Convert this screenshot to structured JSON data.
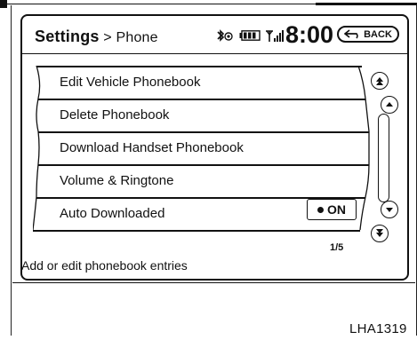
{
  "header": {
    "breadcrumb_settings": "Settings",
    "breadcrumb_separator": ">",
    "breadcrumb_current": "Phone",
    "time": "8:00",
    "back_label": "BACK",
    "status_icons": [
      "bluetooth-icon",
      "battery-icon",
      "signal-icon"
    ]
  },
  "menu": {
    "items": [
      {
        "label": "Edit Vehicle Phonebook"
      },
      {
        "label": "Delete Phonebook"
      },
      {
        "label": "Download Handset Phonebook"
      },
      {
        "label": "Volume & Ringtone"
      },
      {
        "label": "Auto Downloaded",
        "toggle": "ON"
      }
    ],
    "page": "1/5"
  },
  "hint": "Add or edit phonebook entries",
  "figure_code": "LHA1319"
}
